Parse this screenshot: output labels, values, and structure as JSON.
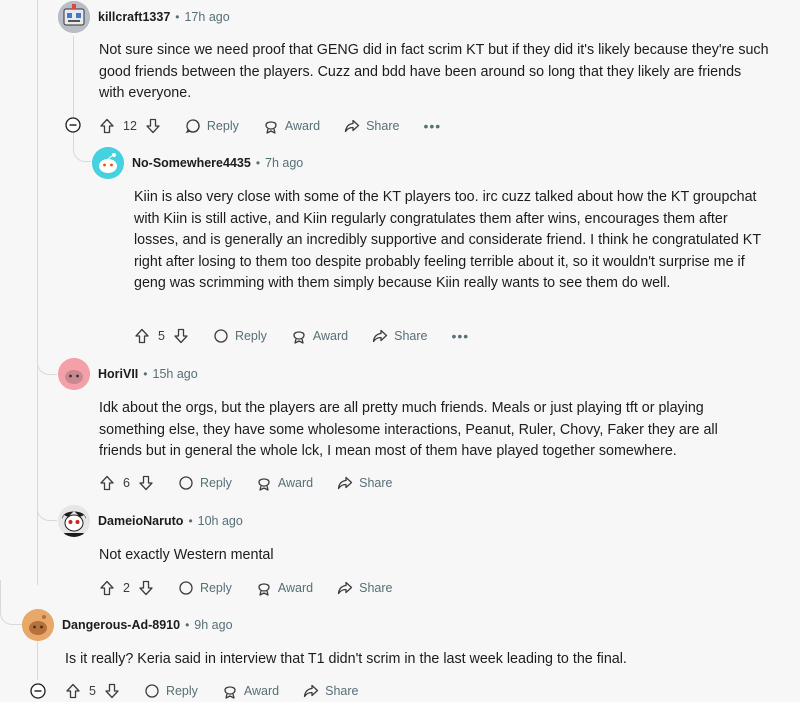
{
  "comments": [
    {
      "author": "killcraft1337",
      "time": "17h ago",
      "body": "Not sure since we need proof that GENG did in fact scrim KT but if they did it's likely because they're such good friends between the players. Cuzz and bdd have been around so long that they likely are friends with everyone.",
      "votes": "12",
      "avatar_color": "#8a8f98"
    },
    {
      "author": "No-Somewhere4435",
      "time": "7h ago",
      "body": "Kiin is also very close with some of the KT players too. irc cuzz talked about how the KT groupchat with Kiin is still active, and Kiin regularly congratulates them after wins, encourages them after losses, and is generally an incredibly supportive and considerate friend. I think he congratulated KT right after losing to them too despite probably feeling terrible about it, so it wouldn't surprise me if geng was scrimming with them simply because Kiin really wants to see them do well.",
      "votes": "5",
      "avatar_color": "#46d1e0"
    },
    {
      "author": "HoriVII",
      "time": "15h ago",
      "body": "Idk about the orgs, but the players are all pretty much friends. Meals or just playing tft or playing something else, they have some wholesome interactions, Peanut, Ruler, Chovy, Faker they are all friends but in general the whole lck, I mean most of them have played together somewhere.",
      "votes": "6",
      "avatar_color": "#f4a0a8"
    },
    {
      "author": "DameioNaruto",
      "time": "10h ago",
      "body": "Not exactly Western mental",
      "votes": "2",
      "avatar_color": "#2a2a2a"
    },
    {
      "author": "Dangerous-Ad-8910",
      "time": "9h ago",
      "body": "Is it really? Keria said in interview that T1 didn't scrim in the last week leading to the final.",
      "votes": "5",
      "avatar_color": "#e8a86a"
    }
  ],
  "labels": {
    "reply": "Reply",
    "award": "Award",
    "share": "Share",
    "more": "•••",
    "separator": "•"
  }
}
